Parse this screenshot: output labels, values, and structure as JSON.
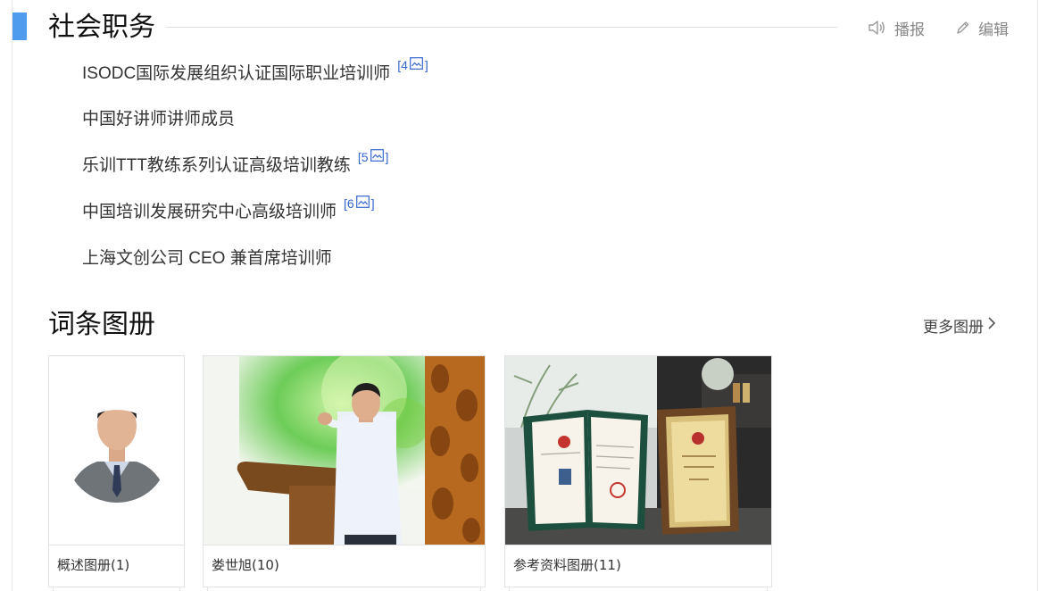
{
  "section": {
    "title": "社会职务",
    "actions": {
      "broadcast_label": "播报",
      "edit_label": "编辑"
    }
  },
  "duties": [
    {
      "text": "ISODC国际发展组织认证国际职业培训师",
      "ref": "4"
    },
    {
      "text": "中国好讲师讲师成员",
      "ref": ""
    },
    {
      "text": "乐训TTT教练系列认证高级培训教练",
      "ref": "5"
    },
    {
      "text": "中国培训发展研究中心高级培训师",
      "ref": "6"
    },
    {
      "text": "上海文创公司 CEO 兼首席培训师",
      "ref": ""
    }
  ],
  "ref_brackets": {
    "open": "[",
    "close": "]"
  },
  "album": {
    "title": "词条图册",
    "more_label": "更多图册",
    "cards": [
      {
        "name": "概述图册",
        "count": "(1)"
      },
      {
        "name": "娄世旭",
        "count": "(10)"
      },
      {
        "name": "参考资料图册",
        "count": "(11)"
      }
    ]
  },
  "colors": {
    "accent_bar": "#4f9cee",
    "ref_link": "#3366cc",
    "text": "#333333",
    "muted": "#888888"
  },
  "icons": {
    "broadcast": "speaker-icon",
    "edit": "pencil-icon",
    "ref": "image-icon",
    "more": "chevron-right-icon"
  }
}
